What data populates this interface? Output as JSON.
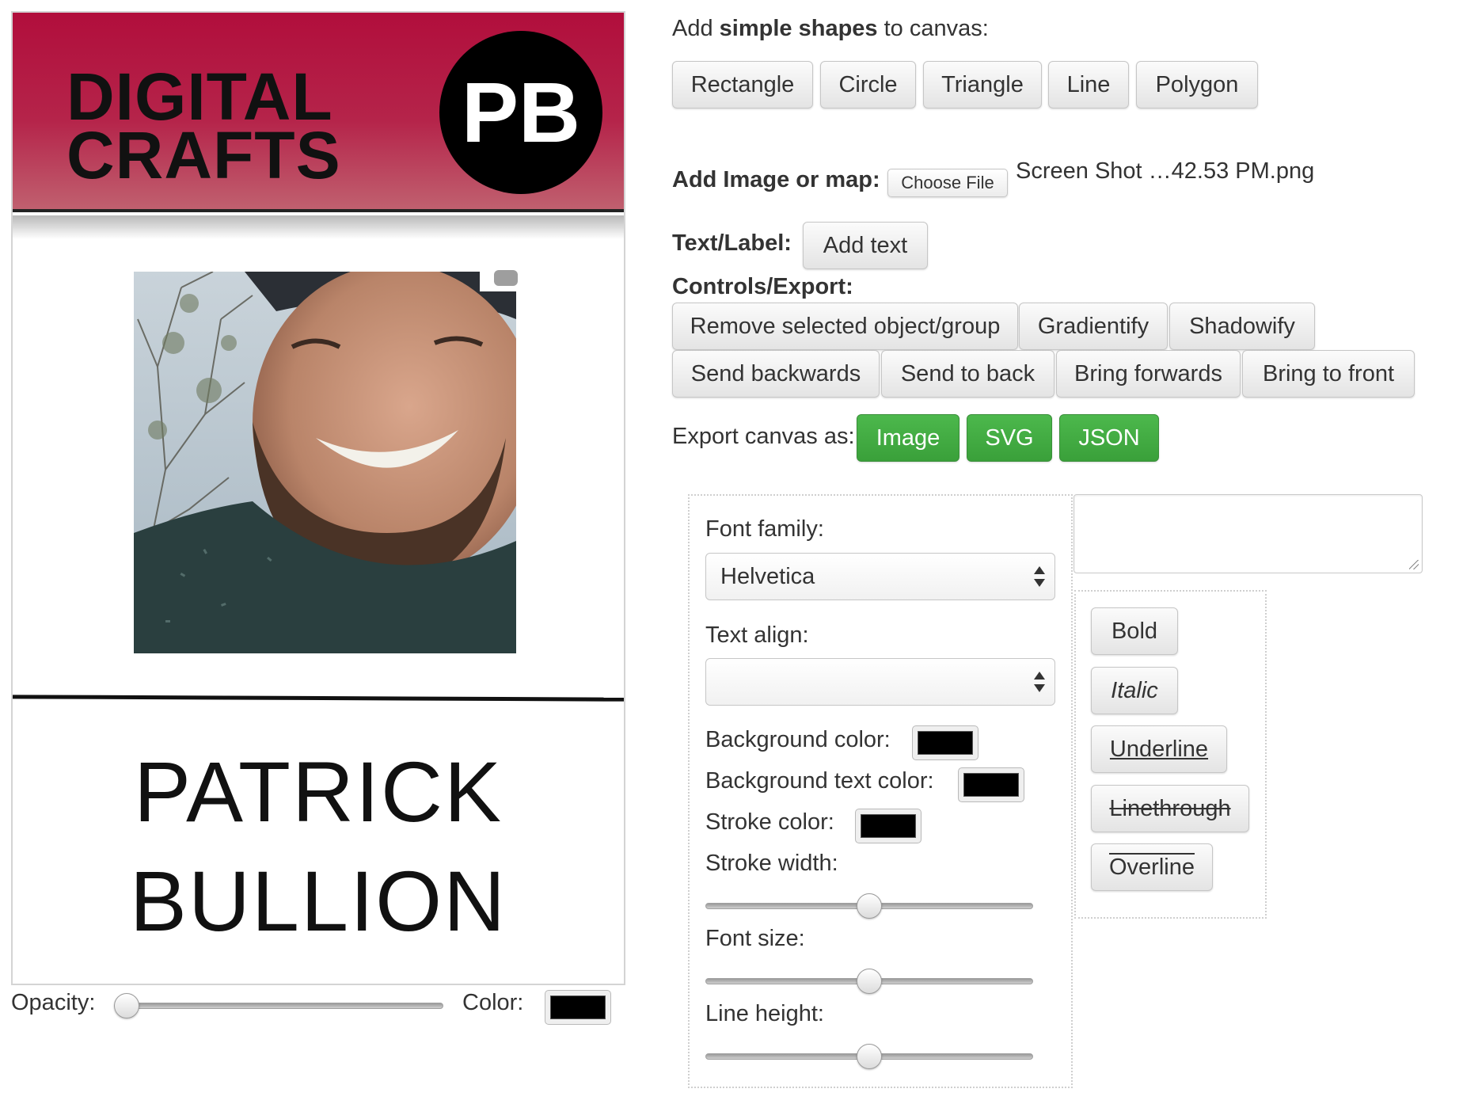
{
  "badge": {
    "brand_line1": "DIGITAL",
    "brand_line2": "CRAFTS",
    "initials": "PB",
    "first_name": "PATRICK",
    "last_name": "BULLION",
    "header_color": "#b10e3c"
  },
  "canvas_controls": {
    "opacity_label": "Opacity:",
    "opacity_value": 0,
    "color_label": "Color:",
    "color_value": "#000000"
  },
  "shapes": {
    "label_prefix": "Add ",
    "label_bold": "simple shapes",
    "label_suffix": " to canvas:",
    "buttons": [
      "Rectangle",
      "Circle",
      "Triangle",
      "Line",
      "Polygon"
    ]
  },
  "image_input": {
    "label": "Add Image or map:",
    "button": "Choose File",
    "file_name": "Screen Shot …42.53 PM.png"
  },
  "text_label": {
    "label": "Text/Label:",
    "button": "Add text"
  },
  "controls": {
    "label": "Controls/Export:",
    "row1": [
      "Remove selected object/group",
      "Gradientify",
      "Shadowify"
    ],
    "row2": [
      "Send backwards",
      "Send to back",
      "Bring forwards",
      "Bring to front"
    ]
  },
  "export": {
    "label": "Export canvas as:",
    "buttons": [
      "Image",
      "SVG",
      "JSON"
    ],
    "accent_color": "#3fa63f"
  },
  "text_props": {
    "font_family_label": "Font family:",
    "font_family_value": "Helvetica",
    "text_align_label": "Text align:",
    "text_align_value": "",
    "bg_color_label": "Background color:",
    "bg_text_color_label": "Background text color:",
    "stroke_color_label": "Stroke color:",
    "stroke_width_label": "Stroke width:",
    "stroke_width_value": 0.5,
    "font_size_label": "Font size:",
    "font_size_value": 0.5,
    "line_height_label": "Line height:",
    "line_height_value": 0.5,
    "textarea_value": ""
  },
  "text_styles": {
    "bold": "Bold",
    "italic": "Italic",
    "underline": "Underline",
    "linethrough": "Linethrough",
    "overline": "Overline"
  }
}
